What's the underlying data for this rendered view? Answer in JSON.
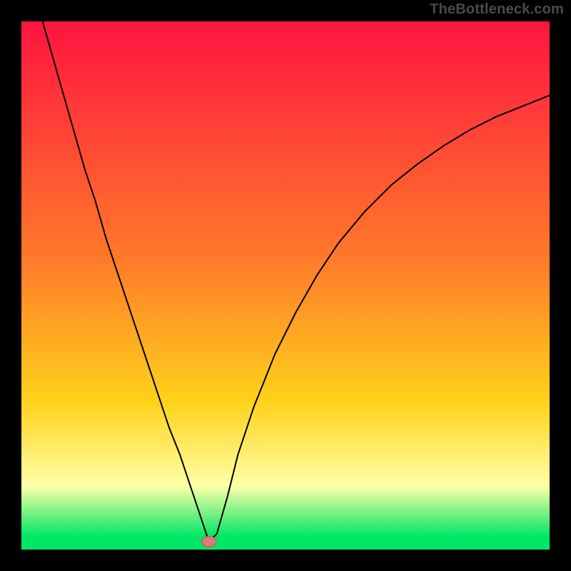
{
  "watermark": "TheBottleneck.com",
  "colors": {
    "frame": "#000000",
    "gradient_top": "#ff1440",
    "gradient_mid_upper": "#ff7a2a",
    "gradient_mid": "#ffd21a",
    "gradient_pale": "#ffffa8",
    "gradient_green": "#00e765",
    "curve": "#000000",
    "marker_fill": "#d87b7b",
    "marker_stroke": "#b85a5a"
  },
  "chart_data": {
    "type": "line",
    "title": "",
    "xlabel": "",
    "ylabel": "",
    "xlim": [
      0,
      100
    ],
    "ylim": [
      0,
      100
    ],
    "series": [
      {
        "name": "bottleneck-curve",
        "x": [
          4,
          6,
          8,
          10,
          12,
          14,
          16,
          18,
          20,
          22,
          24,
          26,
          28,
          30,
          32,
          34,
          35.5,
          37,
          39,
          41,
          44,
          48,
          52,
          56,
          60,
          65,
          70,
          75,
          80,
          85,
          90,
          95,
          100
        ],
        "y": [
          100,
          93,
          86,
          79,
          72,
          66,
          59,
          53,
          47,
          41,
          35,
          29,
          23,
          18,
          12,
          6,
          1.5,
          3,
          10,
          18,
          27,
          37,
          45,
          52,
          58,
          64,
          69,
          73,
          76.5,
          79.5,
          82,
          84,
          86
        ]
      }
    ],
    "marker": {
      "x": 35.5,
      "y": 1.5,
      "rx": 1.4,
      "ry": 1.0
    },
    "gradient_stops": [
      {
        "offset": 0,
        "band": "red-top"
      },
      {
        "offset": 0.45,
        "band": "orange"
      },
      {
        "offset": 0.72,
        "band": "yellow"
      },
      {
        "offset": 0.88,
        "band": "pale-yellow"
      },
      {
        "offset": 0.975,
        "band": "green"
      },
      {
        "offset": 1.0,
        "band": "green"
      }
    ]
  }
}
